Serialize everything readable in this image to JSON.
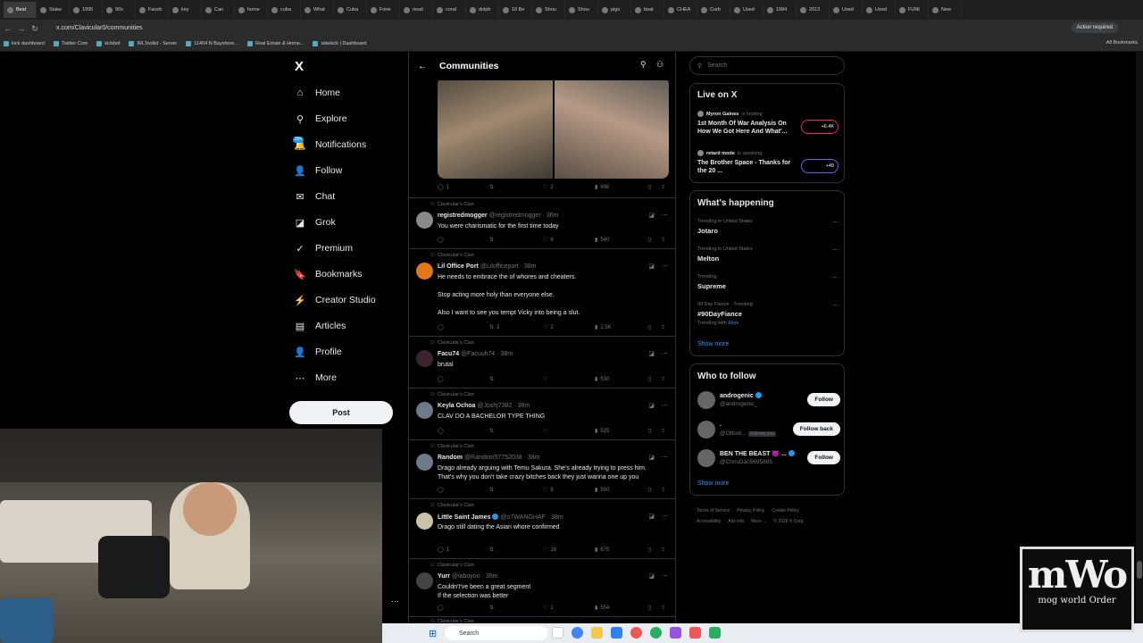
{
  "browser": {
    "tabs": [
      "Best",
      "Stake",
      "1995",
      "90s",
      "Faceb",
      "key",
      "Can",
      "home",
      "cuba",
      "What",
      "Cuba",
      "Forei",
      "most",
      "coral",
      "dolph",
      "10 Be",
      "Shou",
      "Shou",
      "pigs",
      "boat",
      "CHEA",
      "Curb",
      "Used",
      "1994",
      "2013",
      "Used",
      "Used",
      "FUNI",
      "New"
    ],
    "url": "x.com/Clavicular0/communities",
    "action_label": "Action required",
    "bookmarks": [
      "kick dashboard",
      "Twitter Com",
      "kickbot",
      "IRLToolkit - Server",
      "11404 N Bayshore...",
      "Real Estate & Home...",
      "sidekick | Dashboard"
    ],
    "all_bookmarks": "All Bookmarks"
  },
  "nav": {
    "logo": "X",
    "badge": "20+",
    "items": [
      {
        "label": "Home",
        "icon": "⌂"
      },
      {
        "label": "Explore",
        "icon": "⚲"
      },
      {
        "label": "Notifications",
        "icon": "🔔"
      },
      {
        "label": "Follow",
        "icon": "👤"
      },
      {
        "label": "Chat",
        "icon": "✉"
      },
      {
        "label": "Grok",
        "icon": "◪"
      },
      {
        "label": "Premium",
        "icon": "✓"
      },
      {
        "label": "Bookmarks",
        "icon": "🔖"
      },
      {
        "label": "Creator Studio",
        "icon": "⚡"
      },
      {
        "label": "Articles",
        "icon": "▤"
      },
      {
        "label": "Profile",
        "icon": "👤"
      },
      {
        "label": "More",
        "icon": "⋯"
      }
    ],
    "post_label": "Post"
  },
  "center": {
    "title": "Communities",
    "back": "←",
    "first_actions": {
      "replies": "1",
      "retweets": "",
      "likes": "2",
      "views": "698"
    },
    "tweets": [
      {
        "community": "Clavicular's Clan",
        "name": "registredmogger",
        "handle": "@registredmogger · 36m",
        "body": [
          "You were charismatic for the first time today"
        ],
        "replies": "",
        "retweets": "",
        "likes": "6",
        "views": "540",
        "avatar": "#8a8a8a"
      },
      {
        "community": "Clavicular's Clan",
        "name": "Lil Office Port",
        "handle": "@Lilofficeport · 38m",
        "body": [
          "He needs to embrace the of whores and cheaters.",
          "",
          "Stop acting more holy than everyone else.",
          "",
          "Also I want to see you tempt Vicky into being a slut."
        ],
        "replies": "",
        "retweets": "3",
        "likes": "2",
        "views": "2.5K",
        "avatar": "#e0781c"
      },
      {
        "community": "Clavicular's Clan",
        "name": "Facu74",
        "handle": "@Facuuh74 · 38m",
        "body": [
          "brutal"
        ],
        "replies": "",
        "retweets": "",
        "likes": "",
        "views": "530",
        "avatar": "#3a2430"
      },
      {
        "community": "Clavicular's Clan",
        "name": "Keyla Ochoa",
        "handle": "@Joshj7382 · 38m",
        "body": [
          "CLAV DO A BACHELOR TYPE THING"
        ],
        "replies": "",
        "retweets": "",
        "likes": "",
        "views": "525",
        "avatar": "#6d7a8a"
      },
      {
        "community": "Clavicular's Clan",
        "name": "Random",
        "handle": "@Random57752038 · 38m",
        "body": [
          "Drago already arguing with Temu Sakura. She's already trying to press him.",
          "That's why you don't take crazy bitches back they just wanna one up you"
        ],
        "replies": "",
        "retweets": "",
        "likes": "8",
        "views": "550",
        "avatar": "#6d7a8a"
      },
      {
        "community": "Clavicular's Clan",
        "name": "Little Saint James",
        "handle": "@o7WANGHAF · 38m",
        "body": [
          "Drago still dating the Asian whore confirmed"
        ],
        "replies": "1",
        "retweets": "",
        "likes": "16",
        "views": "675",
        "avatar": "#c9c2a8",
        "verified": true
      },
      {
        "community": "Clavicular's Clan",
        "name": "Yurr",
        "handle": "@laboyoo · 39m",
        "body": [
          "Couldn't've been a great segment",
          "If the selection was better"
        ],
        "replies": "",
        "retweets": "",
        "likes": "1",
        "views": "554",
        "avatar": "#444"
      }
    ],
    "last_community": "Clavicular's Clan"
  },
  "right": {
    "search_placeholder": "Search",
    "live_title": "Live on X",
    "live": [
      {
        "host": "Myron Gaines",
        "status": "is hosting",
        "title": "1st Month Of War Analysis On How We Got Here And What'...",
        "count": "+6.4K"
      },
      {
        "host": "retard mode",
        "status": "is speaking",
        "title": "The Brother Space - Thanks for the 20 ...",
        "count": "+49"
      }
    ],
    "happening_title": "What's happening",
    "trends": [
      {
        "context": "Trending in United States",
        "name": "Jotaro"
      },
      {
        "context": "Trending in United States",
        "name": "Melton"
      },
      {
        "context": "Trending",
        "name": "Supreme"
      },
      {
        "context": "90 Day Fiancé · Trending",
        "name": "#90DayFiance",
        "with_label": "Trending with",
        "with": "Elise"
      }
    ],
    "show_more": "Show more",
    "wtf_title": "Who to follow",
    "wtf": [
      {
        "name": "androgenic",
        "handle": "@androgenic_",
        "button": "Follow",
        "follows_you": ""
      },
      {
        "name": ".",
        "handle": "@Ottost...",
        "button": "Follow back",
        "follows_you": "Follows you"
      },
      {
        "name": "BEN THE BEAST 😈 ...",
        "handle": "@ChrisDa05695895",
        "button": "Follow",
        "follows_you": ""
      }
    ],
    "footer": [
      "Terms of Service",
      "Privacy Policy",
      "Cookie Policy",
      "Accessibility",
      "Ads info",
      "More ...",
      "© 2026 X Corp."
    ]
  },
  "taskbar": {
    "search": "Search"
  },
  "overlay": {
    "logo_big": "mWo",
    "logo_small": "mog world Order"
  },
  "colors": {
    "accent": "#1d9bf0",
    "bg": "#000000",
    "border": "#2f3336",
    "muted": "#71767b",
    "live_pill": "#f91880"
  }
}
